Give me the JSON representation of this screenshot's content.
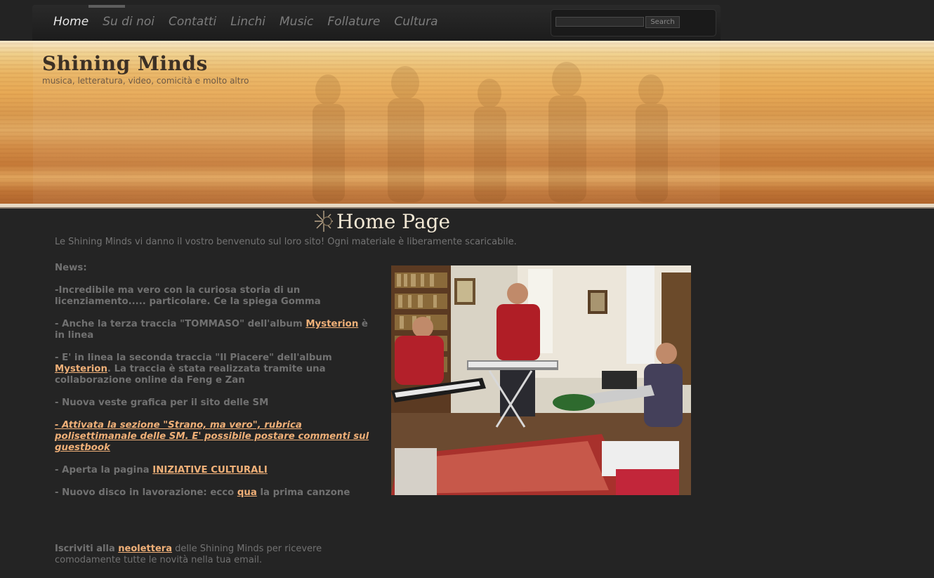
{
  "nav": {
    "items": [
      {
        "label": "Home",
        "active": true
      },
      {
        "label": "Su di noi"
      },
      {
        "label": "Contatti"
      },
      {
        "label": "Linchi"
      },
      {
        "label": "Music"
      },
      {
        "label": "Follature"
      },
      {
        "label": "Cultura"
      }
    ],
    "search_button": "Search"
  },
  "header": {
    "title": "Shining Minds",
    "subtitle": "musica, letteratura, video, comicità e molto altro"
  },
  "main": {
    "heading": "Home Page",
    "intro": "Le Shining Minds vi danno il vostro benvenuto sul loro sito! Ogni materiale è liberamente scaricabile.",
    "news_title": "News:",
    "news": {
      "item1": "-Incredibile ma vero con la curiosa storia di un licenziamento..... particolare. Ce la spiega Gomma",
      "item2_pre": "- Anche la terza traccia \"TOMMASO\" dell'album ",
      "item2_link": "Mysterion",
      "item2_post": " è in linea",
      "item3_pre": "- E' in linea la seconda traccia \"Il Piacere\" dell'album ",
      "item3_link": "Mysterion",
      "item3_post": ". La traccia è stata realizzata tramite una collaborazione online da Feng e Zan",
      "item4": "- Nuova veste grafica per il sito delle SM",
      "item5_link": "- Attivata la sezione \"Strano, ma vero\", rubrica polisettimanale delle SM. E' possibile postare commenti sul guestbook",
      "item6_pre": "- Aperta la pagina ",
      "item6_link": "INIZIATIVE CULTURALI",
      "item7_pre": "- Nuovo disco in lavorazione: ecco ",
      "item7_link": "qua",
      "item7_post": " la prima canzone"
    },
    "newsletter": {
      "pre": "Iscriviti alla ",
      "link": "neolettera",
      "post": " delle Shining Minds per ricevere comodamente tutte le novità nella tua email."
    }
  },
  "colors": {
    "background": "#242424",
    "link": "#f0b078",
    "text": "#747474",
    "heading": "#f1e7d4"
  }
}
